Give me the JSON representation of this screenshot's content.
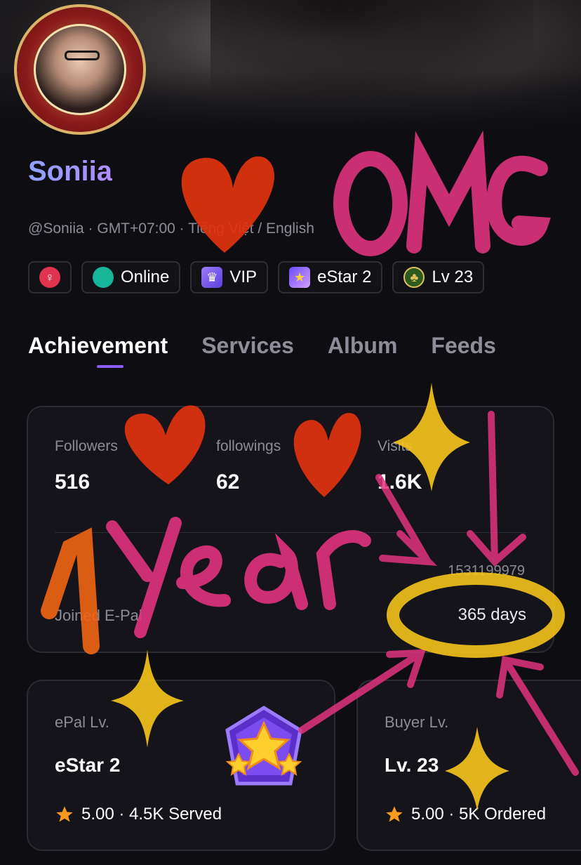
{
  "profile": {
    "name": "Soniia",
    "subinfo": "@Soniia · GMT+07:00 · Tiếng Việt / English"
  },
  "badges": [
    {
      "icon": "female-icon",
      "label": ""
    },
    {
      "icon": "online-dot-icon",
      "label": "Online"
    },
    {
      "icon": "vip-crown-icon",
      "label": "VIP"
    },
    {
      "icon": "estar-icon",
      "label": "eStar 2"
    },
    {
      "icon": "level-icon",
      "label": "Lv 23"
    }
  ],
  "tabs": [
    "Achievement",
    "Services",
    "Album",
    "Feeds"
  ],
  "stats": {
    "followers_label": "Followers",
    "followers_value": "516",
    "followings_label": "followings",
    "followings_value": "62",
    "visits_label": "Visits",
    "visits_value": "1.6K",
    "id": "1531199979",
    "joined_label": "Joined E-Pal",
    "joined_value": "365 days"
  },
  "levels": {
    "epal_label": "ePal Lv.",
    "epal_value": "eStar 2",
    "epal_rating": "5.00 · 4.5K Served",
    "buyer_label": "Buyer Lv.",
    "buyer_value": "Lv. 23",
    "buyer_rating": "5.00 · 5K Ordered"
  },
  "colors": {
    "accent": "#8d5cf6",
    "background": "#0e0e12",
    "online": "#17b59a",
    "doodle_pink": "#e0337e",
    "doodle_yellow": "#f3c21b",
    "doodle_red": "#e2330f"
  }
}
